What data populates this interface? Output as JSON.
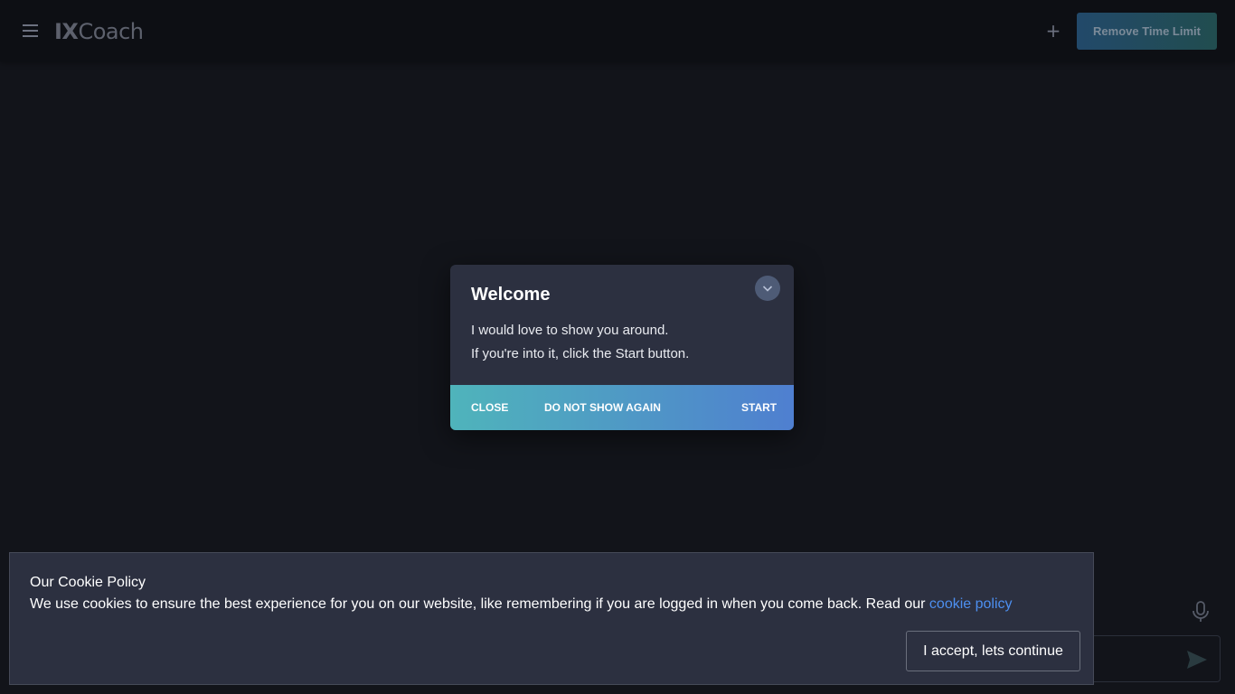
{
  "header": {
    "logo_ix": "IX",
    "logo_coach": "Coach",
    "plus_label": "+",
    "remove_limit_label": "Remove Time Limit"
  },
  "welcome": {
    "title": "Welcome",
    "line1": "I would love to show you around.",
    "line2": "If you're into it, click the Start button.",
    "close_label": "CLOSE",
    "do_not_show_label": "DO NOT SHOW AGAIN",
    "start_label": "START",
    "collapse_icon": "chevron-down-icon"
  },
  "cookie": {
    "title": "Our Cookie Policy",
    "text": "We use cookies to ensure the best experience for you on our website, like remembering if you are logged in when you come back. Read our ",
    "link": "cookie policy",
    "accept_label": "I accept, lets continue"
  },
  "icons": {
    "menu": "menu-icon",
    "mic": "microphone-icon",
    "send": "send-icon"
  },
  "colors": {
    "background": "#12141a",
    "header": "#0d0f14",
    "dialog": "#2c3040",
    "accent_start": "#4fb4bb",
    "accent_end": "#4f7fd0",
    "link": "#4d8ff0"
  }
}
